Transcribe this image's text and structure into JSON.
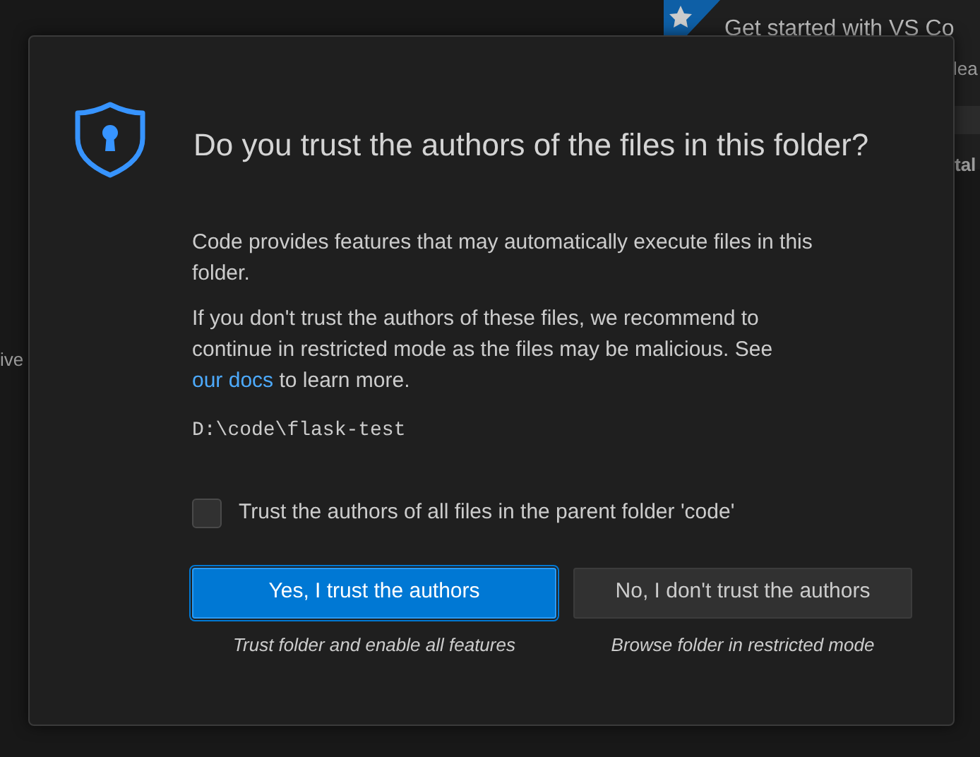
{
  "background": {
    "welcome_title": "Get started with VS Co",
    "fragments": [
      {
        "text": "lea",
        "kind": "right"
      },
      {
        "text": "tal",
        "kind": "right-bold"
      },
      {
        "text": "ive",
        "kind": "left"
      }
    ]
  },
  "dialog": {
    "title": "Do you trust the authors of the files in this folder?",
    "paragraphs": [
      {
        "text": "Code provides features that may automatically execute files in this folder."
      },
      {
        "text": "If you don't trust the authors of these files, we recommend to continue in restricted mode as the files may be malicious. See ",
        "link": "our docs",
        "after": " to learn more."
      }
    ],
    "path": "D:\\code\\flask-test",
    "checkbox": {
      "label": "Trust the authors of all files in the parent folder 'code'",
      "checked": false
    },
    "buttons": [
      {
        "label": "Yes, I trust the authors",
        "caption": "Trust folder and enable all features",
        "kind": "primary"
      },
      {
        "label": "No, I don't trust the authors",
        "caption": "Browse folder in restricted mode",
        "kind": "secondary"
      }
    ]
  }
}
